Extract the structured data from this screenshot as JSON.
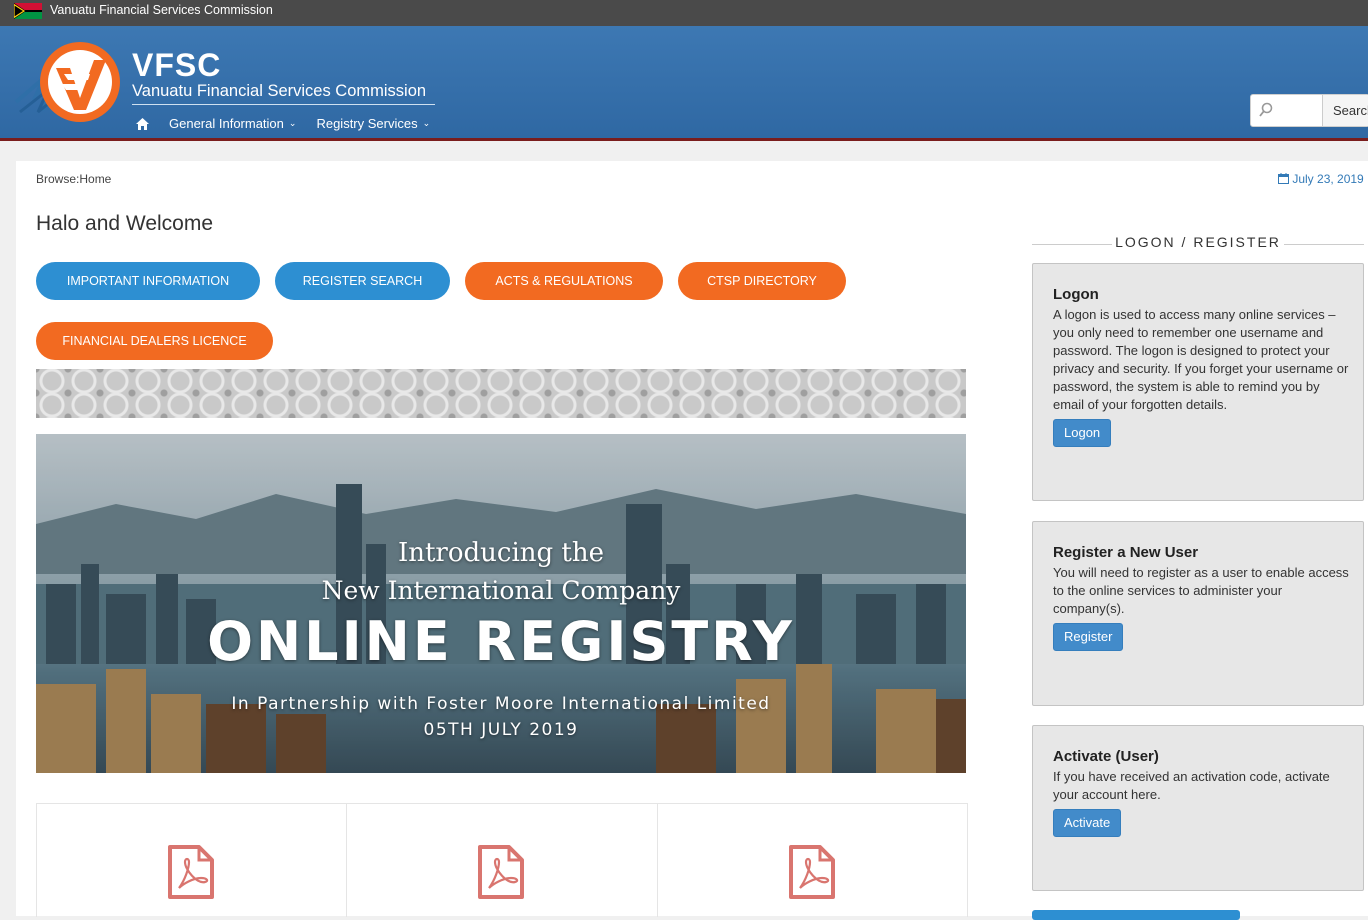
{
  "topbar": {
    "title": "Vanuatu Financial Services Commission"
  },
  "header": {
    "abbr": "VFSC",
    "full_name": "Vanuatu Financial Services Commission",
    "nav": [
      {
        "label": "General Information",
        "icon": "chevron-down-icon"
      },
      {
        "label": "Registry Services",
        "icon": "chevron-down-icon"
      }
    ],
    "search_button": "Search"
  },
  "breadcrumb": "Browse:Home",
  "date": "July 23, 2019",
  "welcome": "Halo and Welcome",
  "buttons": [
    {
      "label": "IMPORTANT INFORMATION",
      "color": "#2d8fd2"
    },
    {
      "label": "REGISTER SEARCH",
      "color": "#2d8fd2"
    },
    {
      "label": "ACTS & REGULATIONS",
      "color": "#f26a21"
    },
    {
      "label": "CTSP DIRECTORY",
      "color": "#f26a21"
    },
    {
      "label": "FINANCIAL DEALERS LICENCE",
      "color": "#f26a21"
    }
  ],
  "banner": {
    "line1": "Introducing the",
    "line2": "New International Company",
    "line3": "ONLINE REGISTRY",
    "line4": "In Partnership with Foster Moore International Limited",
    "line5": "05TH JULY 2019"
  },
  "sidebar": {
    "heading": "LOGON / REGISTER",
    "panels": [
      {
        "title": "Logon",
        "text": "A logon is used to access many online services – you only need to remember one username and password. The logon is designed to protect your privacy and security. If you forget your username or password, the system is able to remind you by email of your forgotten details.",
        "button": "Logon"
      },
      {
        "title": "Register a New User",
        "text": "You will need to register as a user to enable access to the online services to administer your company(s).",
        "button": "Register"
      },
      {
        "title": "Activate (User)",
        "text": "If you have received an activation code, activate your account here.",
        "button": "Activate"
      }
    ]
  }
}
